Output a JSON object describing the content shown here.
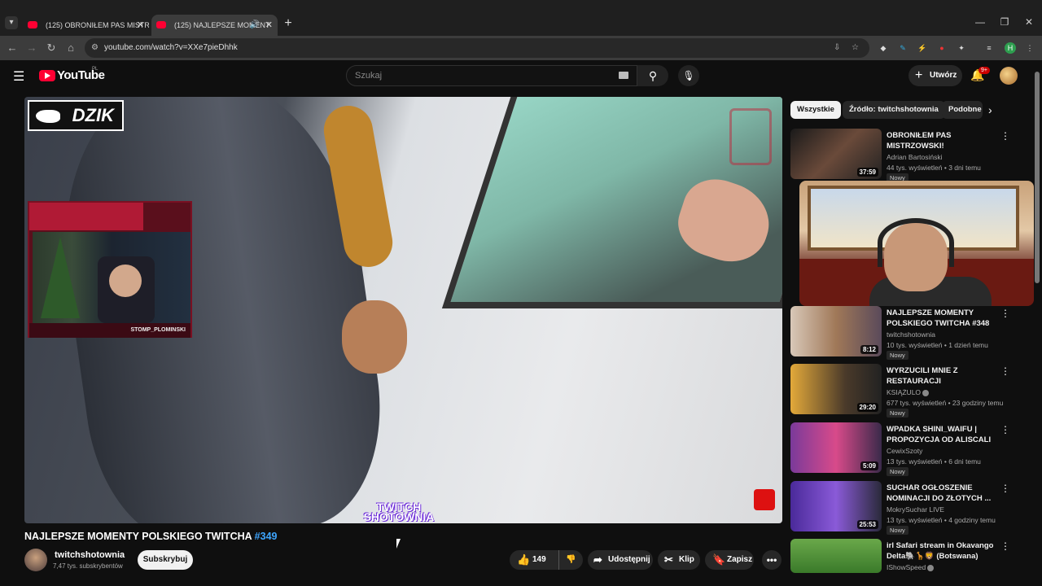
{
  "browser": {
    "tabs": [
      {
        "title": "(125) OBRONIŁEM PAS MISTRZ",
        "active": false
      },
      {
        "title": "(125) NAJLEPSZE MOMENT",
        "active": true
      }
    ],
    "url": "youtube.com/watch?v=XXe7pieDhhk",
    "profile_initial": "H"
  },
  "header": {
    "logo_text": "YouTube",
    "region": "PL",
    "search_placeholder": "Szukaj",
    "create_label": "Utwórz",
    "notifications_badge": "9+"
  },
  "player": {
    "overlay_brand": "DZIK",
    "cam_footer": "STOMP_PLOMINSKI",
    "watermark": "TWITCH SHOTOWNIA"
  },
  "video": {
    "title": "NAJLEPSZE MOMENTY POLSKIEGO TWITCHA",
    "title_tag": "#349",
    "channel_name": "twitchshotownia",
    "channel_subs": "7,47 tys. subskrybentów",
    "subscribe_label": "Subskrybuj",
    "likes": "149",
    "share_label": "Udostępnij",
    "clip_label": "Klip",
    "save_label": "Zapisz"
  },
  "sidebar": {
    "chips": [
      "Wszystkie",
      "Źródło: twitchshotownia",
      "Podobne"
    ],
    "recommendations": [
      {
        "title": "OBRONIŁEM PAS MISTRZOWSKI!",
        "channel": "Adrian Bartosiński",
        "meta": "44 tys. wyświetleń • 3 dni temu",
        "badge": "Nowy",
        "duration": "37:59"
      },
      {
        "title": "NAJLEPSZE MOMENTY POLSKIEGO TWITCHA #348",
        "channel": "twitchshotownia",
        "meta": "10 tys. wyświetleń • 1 dzień temu",
        "badge": "Nowy",
        "duration": "8:12"
      },
      {
        "title": "WYRZUCILI MNIE Z RESTAURACJI",
        "channel": "KSIĄŻULO",
        "meta": "677 tys. wyświetleń • 23 godziny temu",
        "badge": "Nowy",
        "duration": "29:20"
      },
      {
        "title": "WPADKA SHINI_WAIFU | PROPOZYCJA OD ALISCALI D...",
        "channel": "CewixSzoty",
        "meta": "13 tys. wyświetleń • 6 dni temu",
        "badge": "Nowy",
        "duration": "5:09"
      },
      {
        "title": "SUCHAR OGŁOSZENIE NOMINACJI DO ZŁOTYCH ...",
        "channel": "MokrySuchar LIVE",
        "meta": "13 tys. wyświetleń • 4 godziny temu",
        "badge": "Nowy",
        "duration": "25:53"
      },
      {
        "title": "irl Safari stream in Okavango Delta🐘🦒🦁 (Botswana)",
        "channel": "IShowSpeed",
        "meta": "",
        "badge": "",
        "duration": ""
      }
    ]
  }
}
